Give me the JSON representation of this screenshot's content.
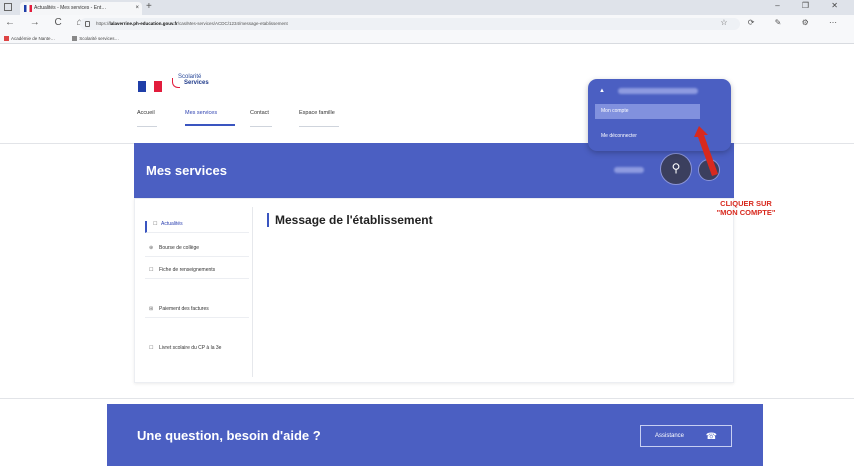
{
  "browser": {
    "tab_title": "Actualités - Mes services - Ent…",
    "tab_close": "×",
    "new_tab": "+",
    "window_controls": "– ❐ ✕",
    "nav_icons": "← → C ⌂",
    "url_prefix": "https://",
    "url_domain": "lalaverrine.ph-education.gouv.fr",
    "url_path": "/cas/Mes-services/ACDC/1234/message-etablissement",
    "browser_icons": "☆ ⟳ ✎ ⚙ ⋯",
    "bookmarks": [
      "Académie de Nante…",
      "Scolarité services…"
    ]
  },
  "site": {
    "logo_line1": "Scolarité",
    "logo_line2": "Services",
    "nav": [
      "Accueil",
      "Mes services",
      "Contact",
      "Espace famille"
    ]
  },
  "dropdown": {
    "user_icon": "▲",
    "mon_compte": "Mon compte",
    "deconnecter": "Me déconnecter"
  },
  "panel": {
    "title": "Mes services",
    "user_button_icon": "⚲"
  },
  "sidebar": {
    "items": [
      {
        "icon": "☐",
        "label": "Actualités"
      },
      {
        "icon": "⊕",
        "label": "Bourse de collège"
      },
      {
        "icon": "☐",
        "label": "Fiche de renseignements"
      },
      {
        "icon": "⊞",
        "label": "Paiement des factures"
      },
      {
        "icon": "☐",
        "label": "Livret scolaire du CP à la 3e"
      }
    ]
  },
  "content": {
    "title": "Message de l'établissement"
  },
  "annotation": {
    "line1": "CLIQUER SUR",
    "line2": "\"MON COMPTE\""
  },
  "help": {
    "question": "Une question, besoin d'aide ?",
    "assistance": "Assistance",
    "assistance_icon": "☎"
  },
  "colors": {
    "brand_blue": "#4b5fc2",
    "annotation_red": "#d8291e"
  }
}
